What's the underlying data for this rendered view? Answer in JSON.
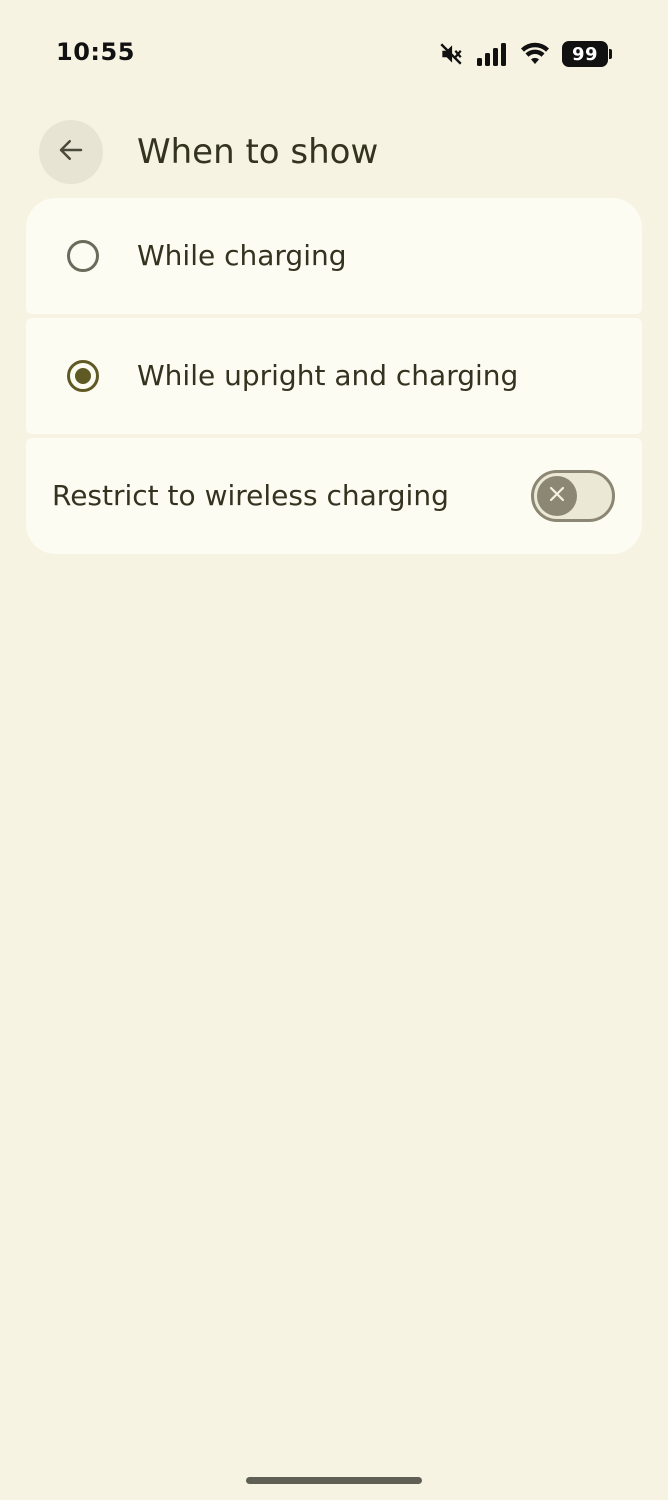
{
  "status_bar": {
    "time": "10:55",
    "battery_level": "99",
    "icons": [
      "muted-icon",
      "cellular-signal-icon",
      "wifi-icon",
      "battery-icon"
    ]
  },
  "app_bar": {
    "back_icon": "arrow-back-icon",
    "title": "When to show"
  },
  "options": [
    {
      "label": "While charging",
      "selected": false
    },
    {
      "label": "While upright and charging",
      "selected": true
    }
  ],
  "wireless_toggle": {
    "label": "Restrict to wireless charging",
    "enabled": false,
    "thumb_icon": "close-icon"
  },
  "colors": {
    "background": "#f6f3e3",
    "card": "#fdfcf3",
    "accent": "#5f5a24",
    "text": "#34331f"
  }
}
